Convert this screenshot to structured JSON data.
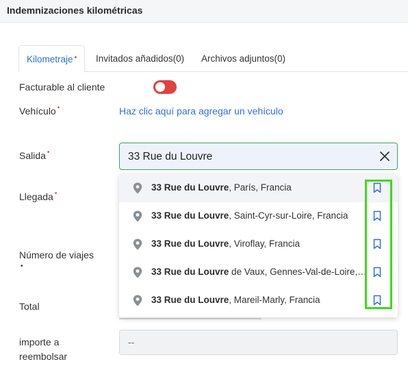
{
  "header": {
    "title": "Indemnizaciones kilométricas"
  },
  "tabs": [
    {
      "label": "Kilometraje",
      "required": "•"
    },
    {
      "label": "Invitados añadidos(0)"
    },
    {
      "label": "Archivos adjuntos(0)"
    }
  ],
  "form": {
    "facturable_label": "Facturable al cliente",
    "vehiculo_label": "Vehículo",
    "vehiculo_link": "Haz clic aquí para agregar un vehículo",
    "salida_label": "Salida",
    "salida_value": "33 Rue du Louvre",
    "llegada_label": "Llegada",
    "viajes_label": "Número de viajes",
    "total_label": "Total",
    "importe_label_1": "importe a",
    "importe_label_2": "reembolsar",
    "importe_value": "--",
    "required_mark": "•"
  },
  "suggestions": [
    {
      "bold": "33 Rue du Louvre",
      "rest": ", París, Francia"
    },
    {
      "bold": "33 Rue du Louvre",
      "rest": ", Saint-Cyr-sur-Loire, Francia"
    },
    {
      "bold": "33 Rue du Louvre",
      "rest": ", Viroflay, Francia"
    },
    {
      "bold": "33 Rue du Louvre",
      "rest": " de Vaux, Gennes-Val-de-Loire, Francia"
    },
    {
      "bold": "33 Rue du Louvre",
      "rest": ", Mareil-Marly, Francia"
    }
  ],
  "colors": {
    "accent": "#2d6fe0",
    "toggle_off": "#e2413f",
    "input_focus_border": "#3aa55b",
    "annotation_box": "#3ddc14",
    "required": "#d64a3a"
  },
  "icons": {
    "clear": "close-icon",
    "location": "map-pin-icon",
    "save": "bookmark-icon"
  }
}
